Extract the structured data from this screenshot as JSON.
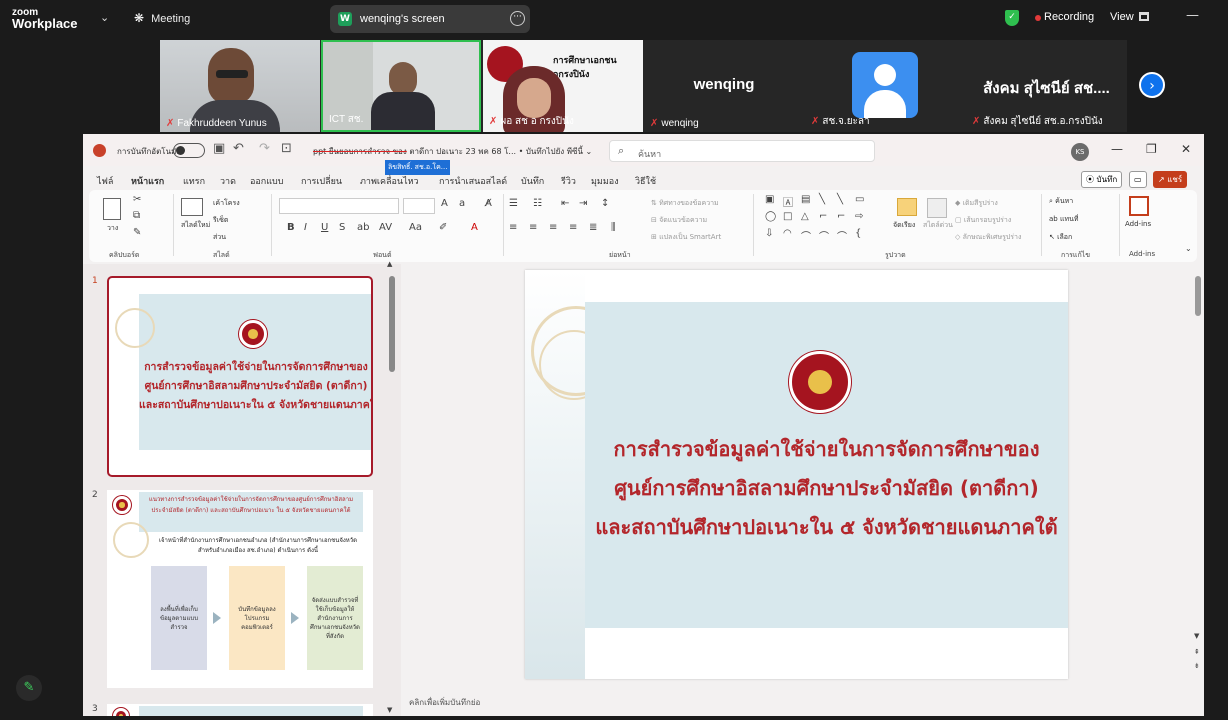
{
  "zoom": {
    "logo_top": "zoom",
    "logo_bottom": "Workplace",
    "chevron": "⌄",
    "meeting_label": "Meeting",
    "share_initial": "W",
    "share_label": "wenqing's screen",
    "recording_label": "Recording",
    "view_label": "View",
    "minimize": "—",
    "next_arrow": "›"
  },
  "participants": [
    {
      "name": "Fakhruddeen Yunus"
    },
    {
      "name": "ICT สช."
    },
    {
      "name": "ผอ สช อ กรงปินัง"
    },
    {
      "name": "wenqing",
      "display": "wenqing"
    },
    {
      "name": "สช.จ.ยะลา"
    },
    {
      "name": "สังคม สุไซนีย์ สช.อ.กรงปินัง",
      "display": "สังคม สุไซนีย์ สช...."
    }
  ],
  "ppt": {
    "autosave_label": "การบันทึกอัตโนมัติ",
    "doc_title_strike": "ppt ยืนยอบการสำรวจ ของ",
    "doc_title_rest": " ตาดีกา ปอเนาะ 23 พค 68 โ... • บันทึกไปยัง พีซีนี้ ⌄",
    "tooltip": "ลิขสิทธิ์. สช.อ.โค...",
    "search_placeholder": "ค้นหา",
    "avatar_initials": "KS",
    "tabs": [
      "ไฟล์",
      "หน้าแรก",
      "แทรก",
      "วาด",
      "ออกแบบ",
      "การเปลี่ยน",
      "ภาพเคลื่อนไหว",
      "การนำเสนอสไลด์",
      "บันทึก",
      "รีวิว",
      "มุมมอง",
      "วิธีใช้"
    ],
    "record_btn": "บันทึก",
    "share_btn": "แชร์",
    "ribbon_groups": [
      "คลิปบอร์ด",
      "สไลด์",
      "ฟอนต์",
      "ย่อหน้า",
      "รูปวาด",
      "การแก้ไข",
      "Add-ins"
    ],
    "ribbon": {
      "paste": "วาง",
      "new_slide": "สไลด์ใหม่",
      "layout": "เค้าโครง",
      "reset": "รีเซ็ต",
      "section": "ส่วน",
      "text_direction": "ทิศทางของข้อความ",
      "align_text": "จัดแนวข้อความ",
      "smartart": "แปลงเป็น SmartArt",
      "arrange": "จัดเรียง",
      "quick_styles": "สไตล์ด่วน",
      "shape_fill": "เติมสีรูปร่าง",
      "shape_outline": "เส้นกรอบรูปร่าง",
      "shape_effects": "ลักษณะพิเศษรูปร่าง",
      "find": "ค้นหา",
      "replace": "แทนที่",
      "select": "เลือก",
      "addins": "Add-ins"
    },
    "slides": [
      {
        "number": "1"
      },
      {
        "number": "2"
      },
      {
        "number": "3"
      }
    ],
    "slide2": {
      "heading": "แนวทางการสำรวจข้อมูลค่าใช้จ่ายในการจัดการศึกษาของศูนย์การศึกษาอิสลามประจำมัสยิด (ตาดีกา) และสถาบันศึกษาปอเนาะ ใน ๕ จังหวัดชายแดนภาคใต้",
      "intro": "เจ้าหน้าที่สำนักงานการศึกษาเอกชนอำเภอ (สำนักงานการศึกษาเอกชนจังหวัดสำหรับอำเภอเมือง สช.อำเภอ) ดำเนินการ ดังนี้",
      "box1": "ลงพื้นที่เพื่อเก็บข้อมูลตามแบบสำรวจ",
      "box2": "บันทึกข้อมูลลงโปรแกรมคอมพิวเตอร์",
      "box3": "จัดส่งแบบสำรวจที่ใช้เก็บข้อมูลให้สำนักงานการศึกษาเอกชนจังหวัดที่สังกัด"
    },
    "main_title_lines": [
      "การสำรวจข้อมูลค่าใช้จ่ายในการจัดการศึกษาของ",
      "ศูนย์การศึกษาอิสลามศึกษาประจำมัสยิด (ตาดีกา)",
      "และสถาบันศึกษาปอเนาะใน ๕ จังหวัดชายแดนภาคใต้"
    ],
    "notes_placeholder": "คลิกเพื่อเพิ่มบันทึกย่อ"
  },
  "video_tiles": {
    "tile3_text": "การศึกษาเอกชน\nอกรงปินัง"
  },
  "colors": {
    "accent": "#c43e1c",
    "title_red": "#b3262b",
    "zoom_blue": "#0e72ed"
  }
}
